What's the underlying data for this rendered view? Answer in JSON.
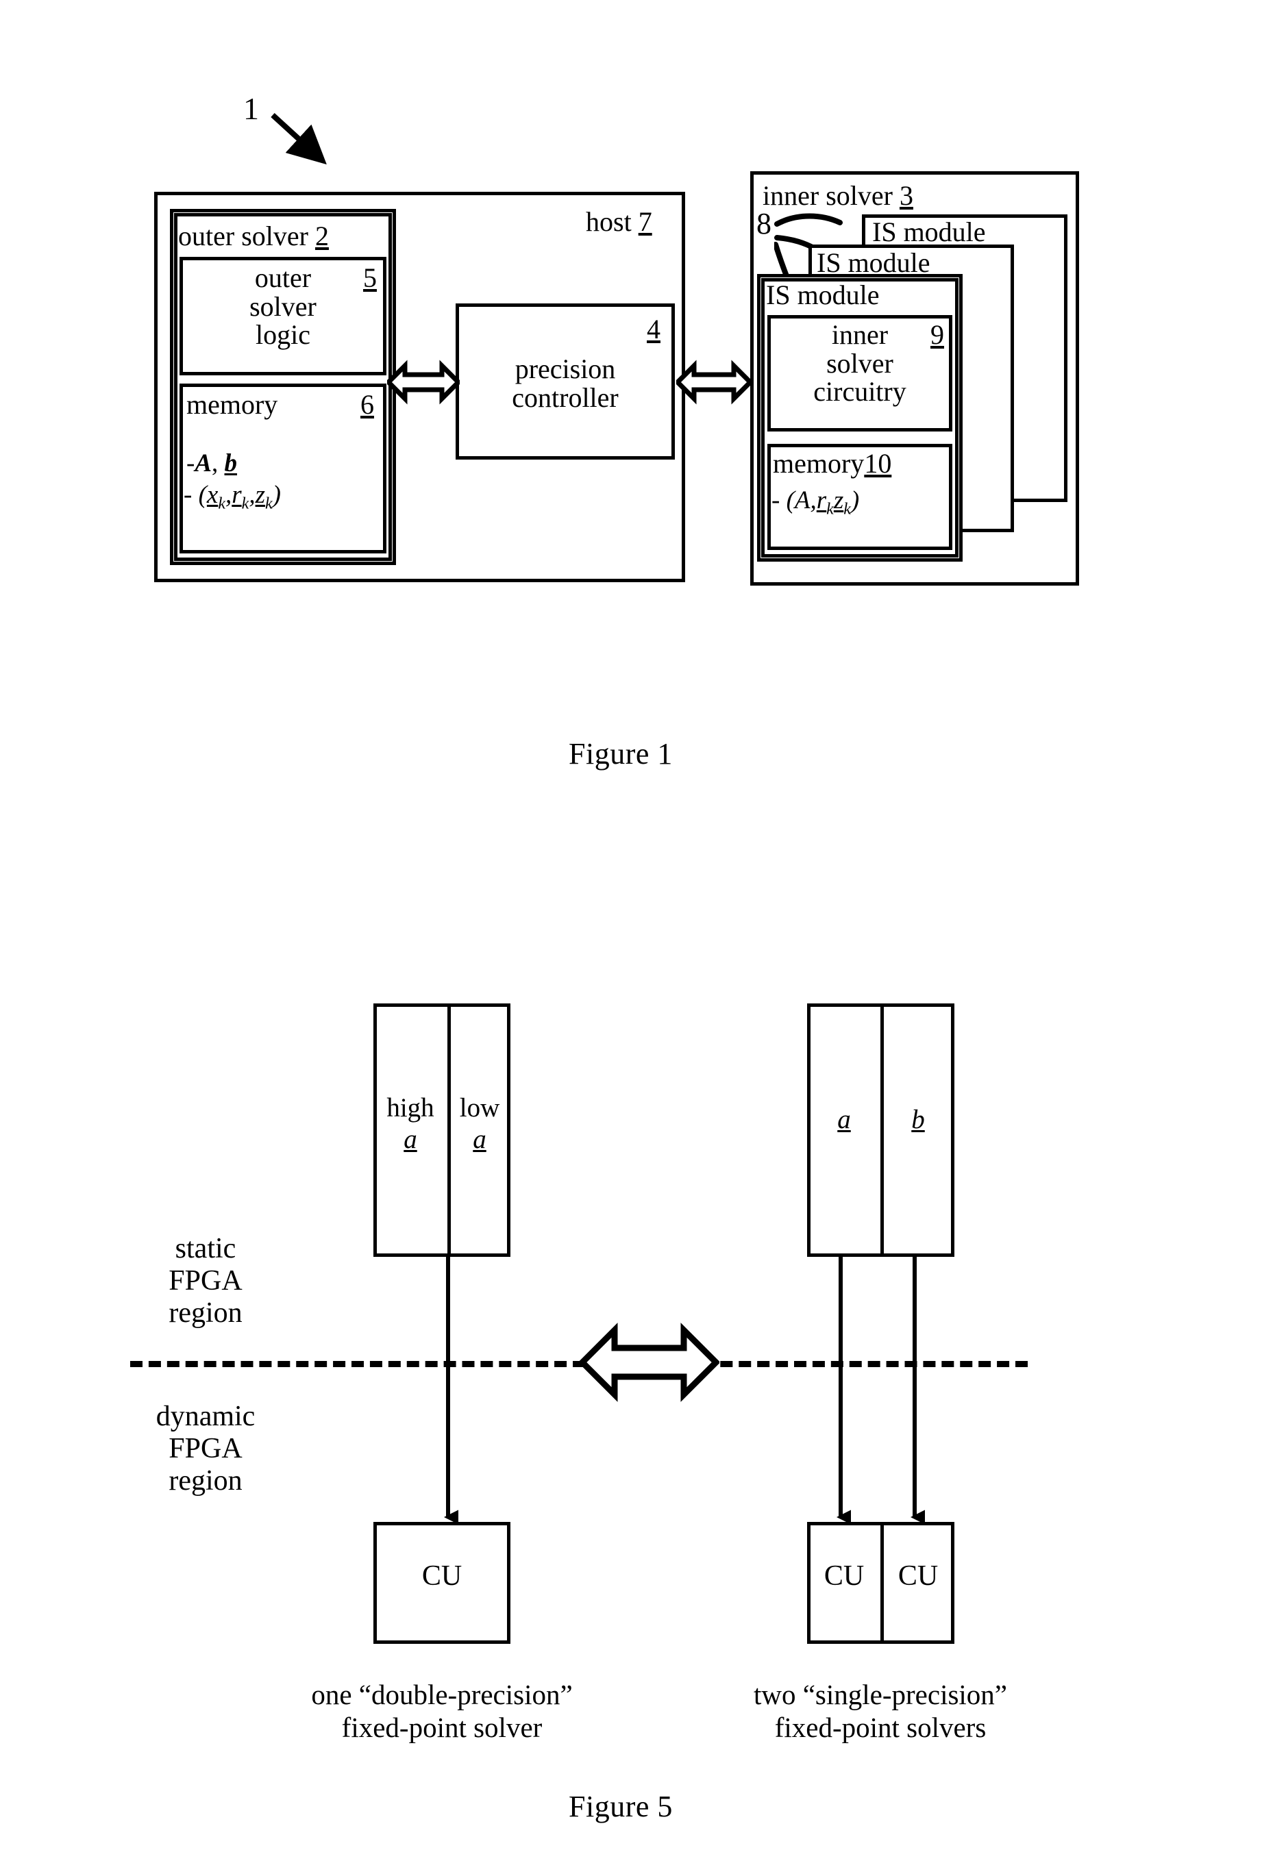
{
  "figure1": {
    "caption": "Figure 1",
    "system_ref": "1",
    "host": {
      "label": "host",
      "ref": "7"
    },
    "outer_solver": {
      "label": "outer solver",
      "ref": "2"
    },
    "outer_solver_logic": {
      "line1": "outer",
      "line2": "solver",
      "line3": "logic",
      "ref": "5"
    },
    "outer_memory": {
      "label": "memory",
      "ref": "6",
      "items": [
        "-A, b",
        "-(xk,rk,zk)"
      ],
      "item1_plain": "-",
      "item1_A": "A",
      "item1_comma": ", ",
      "item1_b": "b",
      "item2_prefix": "- (",
      "item2_x": "x",
      "item2_sub1": "k",
      "item2_sep1": ",",
      "item2_r": "r",
      "item2_sub2": "k",
      "item2_sep2": ",",
      "item2_z": "z",
      "item2_sub3": "k",
      "item2_suffix": ")"
    },
    "precision_controller": {
      "line1": "precision",
      "line2": "controller",
      "ref": "4"
    },
    "inner_solver": {
      "label": "inner solver",
      "ref": "3"
    },
    "is_module_ref": "8",
    "is_modules": [
      {
        "label": "IS module"
      },
      {
        "label": "IS module"
      },
      {
        "label": "IS module"
      }
    ],
    "inner_solver_circuitry": {
      "line1": "inner",
      "line2": "solver",
      "line3": "circuitry",
      "ref": "9"
    },
    "inner_memory": {
      "label": "memory",
      "ref": "10",
      "item": "-(A,rk,zk)",
      "item_prefix": "- (",
      "item_A": "A",
      "item_sep1": ",",
      "item_r": "r",
      "item_sub1": "k",
      "item_sep2": ",",
      "item_z": "z",
      "item_sub2": "k",
      "item_suffix": ")"
    }
  },
  "figure5": {
    "caption": "Figure 5",
    "static_region": {
      "line1": "static",
      "line2": "FPGA",
      "line3": "region"
    },
    "dynamic_region": {
      "line1": "dynamic",
      "line2": "FPGA",
      "line3": "region"
    },
    "left": {
      "reg1": {
        "line1": "high",
        "line2": "a"
      },
      "reg2": {
        "line1": "low",
        "line2": "a"
      },
      "cu": "CU",
      "caption_line1": "one “double-precision”",
      "caption_line2": "fixed-point solver"
    },
    "right": {
      "reg1": {
        "line2": "a"
      },
      "reg2": {
        "line2": "b"
      },
      "cu1": "CU",
      "cu2": "CU",
      "caption_line1": "two “single-precision”",
      "caption_line2": "fixed-point solvers"
    }
  }
}
